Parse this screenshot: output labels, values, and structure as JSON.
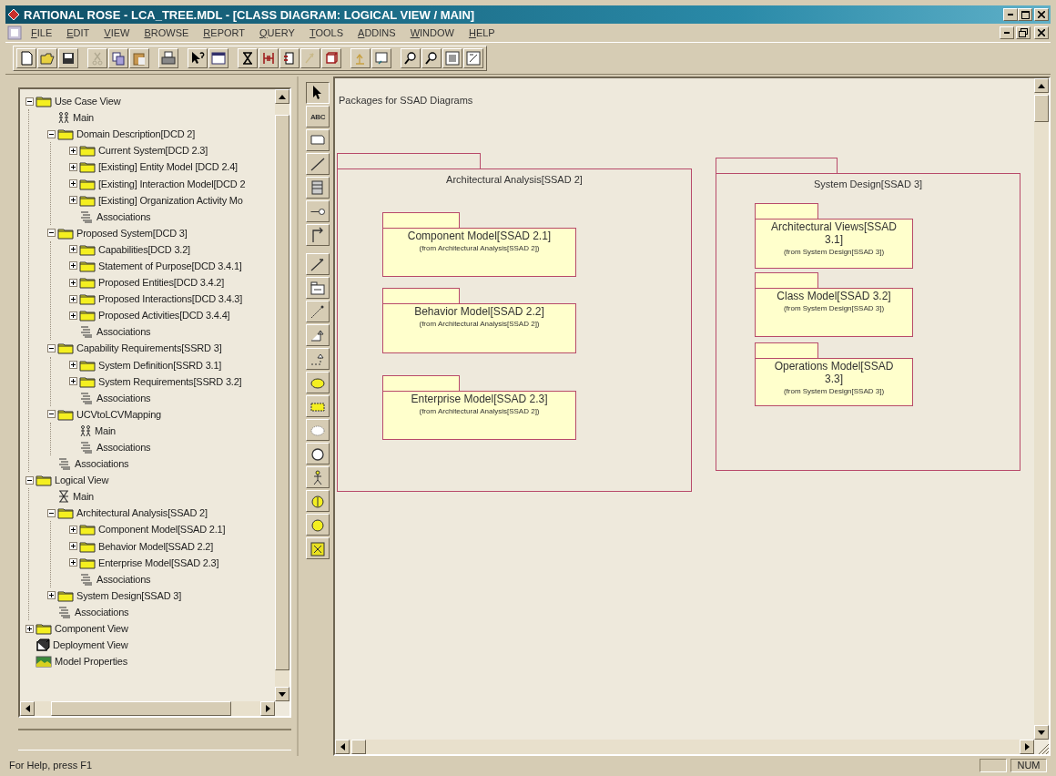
{
  "window": {
    "title": "RATIONAL ROSE - LCA_TREE.MDL - [CLASS DIAGRAM: LOGICAL VIEW / MAIN]"
  },
  "menu": [
    "FILE",
    "EDIT",
    "VIEW",
    "BROWSE",
    "REPORT",
    "QUERY",
    "TOOLS",
    "ADDINS",
    "WINDOW",
    "HELP"
  ],
  "browser": {
    "items": [
      {
        "label": "Use Case View",
        "kind": "folder",
        "expanded": true,
        "children": [
          {
            "label": "Main",
            "kind": "usecase-diagram"
          },
          {
            "label": "Domain Description[DCD 2]",
            "kind": "folder",
            "expanded": true,
            "children": [
              {
                "label": "Current System[DCD 2.3]",
                "kind": "folder",
                "expanded": false
              },
              {
                "label": "[Existing] Entity Model [DCD 2.4]",
                "kind": "folder",
                "expanded": false
              },
              {
                "label": "[Existing] Interaction Model[DCD 2",
                "kind": "folder",
                "expanded": false
              },
              {
                "label": "[Existing] Organization Activity Mo",
                "kind": "folder",
                "expanded": false
              },
              {
                "label": "Associations",
                "kind": "associations"
              }
            ]
          },
          {
            "label": "Proposed System[DCD 3]",
            "kind": "folder",
            "expanded": true,
            "children": [
              {
                "label": "Capabilities[DCD 3.2]",
                "kind": "folder",
                "expanded": false
              },
              {
                "label": "Statement of Purpose[DCD 3.4.1]",
                "kind": "folder",
                "expanded": false
              },
              {
                "label": "Proposed Entities[DCD 3.4.2]",
                "kind": "folder",
                "expanded": false
              },
              {
                "label": "Proposed Interactions[DCD 3.4.3]",
                "kind": "folder",
                "expanded": false
              },
              {
                "label": "Proposed Activities[DCD 3.4.4]",
                "kind": "folder",
                "expanded": false
              },
              {
                "label": "Associations",
                "kind": "associations"
              }
            ]
          },
          {
            "label": "Capability Requirements[SSRD 3]",
            "kind": "folder",
            "expanded": true,
            "children": [
              {
                "label": "System Definition[SSRD 3.1]",
                "kind": "folder",
                "expanded": false
              },
              {
                "label": "System Requirements[SSRD 3.2]",
                "kind": "folder",
                "expanded": false
              },
              {
                "label": "Associations",
                "kind": "associations"
              }
            ]
          },
          {
            "label": "UCVtoLCVMapping",
            "kind": "folder",
            "expanded": true,
            "children": [
              {
                "label": "Main",
                "kind": "usecase-diagram"
              },
              {
                "label": "Associations",
                "kind": "associations"
              }
            ]
          },
          {
            "label": "Associations",
            "kind": "associations"
          }
        ]
      },
      {
        "label": "Logical View",
        "kind": "folder",
        "expanded": true,
        "children": [
          {
            "label": "Main",
            "kind": "class-diagram"
          },
          {
            "label": "Architectural Analysis[SSAD 2]",
            "kind": "folder",
            "expanded": true,
            "children": [
              {
                "label": "Component Model[SSAD 2.1]",
                "kind": "folder",
                "expanded": false
              },
              {
                "label": "Behavior Model[SSAD 2.2]",
                "kind": "folder",
                "expanded": false
              },
              {
                "label": "Enterprise Model[SSAD 2.3]",
                "kind": "folder",
                "expanded": false
              },
              {
                "label": "Associations",
                "kind": "associations"
              }
            ]
          },
          {
            "label": "System Design[SSAD 3]",
            "kind": "folder",
            "expanded": false
          },
          {
            "label": "Associations",
            "kind": "associations"
          }
        ]
      },
      {
        "label": "Component View",
        "kind": "folder",
        "expanded": false
      },
      {
        "label": "Deployment View",
        "kind": "deployment"
      },
      {
        "label": "Model Properties",
        "kind": "properties"
      }
    ]
  },
  "palette": {
    "text_tool": "ABC"
  },
  "diagram": {
    "note": "Packages for SSAD Diagrams",
    "packages": [
      {
        "name": "Architectural Analysis[SSAD 2]",
        "packages": [
          {
            "name": "Component Model[SSAD 2.1]",
            "origin": "(from Architectural Analysis[SSAD 2])"
          },
          {
            "name": "Behavior Model[SSAD 2.2]",
            "origin": "(from Architectural Analysis[SSAD 2])"
          },
          {
            "name": "Enterprise Model[SSAD 2.3]",
            "origin": "(from Architectural Analysis[SSAD 2])"
          }
        ]
      },
      {
        "name": "System Design[SSAD 3]",
        "packages": [
          {
            "name": "Architectural Views[SSAD 3.1]",
            "origin": "(from System Design[SSAD 3])"
          },
          {
            "name": "Class Model[SSAD 3.2]",
            "origin": "(from System Design[SSAD 3])"
          },
          {
            "name": "Operations Model[SSAD 3.3]",
            "origin": "(from System Design[SSAD 3])"
          }
        ]
      }
    ]
  },
  "status_bar": {
    "message": "For Help, press F1",
    "indicator": "NUM"
  }
}
